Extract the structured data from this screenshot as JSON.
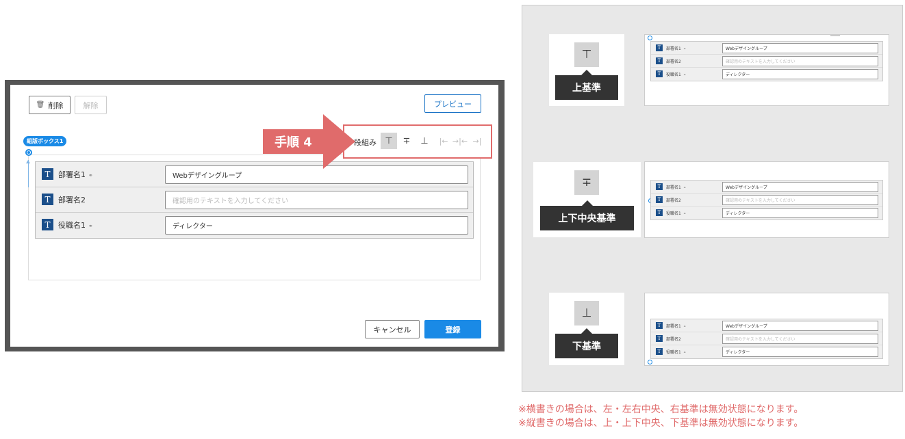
{
  "dialog": {
    "delete_label": "削除",
    "clear_label": "解除",
    "preview_label": "プレビュー",
    "box_tag": "組版ボックス1",
    "layout_label": "段組み",
    "cancel_label": "キャンセル",
    "register_label": "登録",
    "rows": [
      {
        "label": "部署名1",
        "value": "Webデザイングループ",
        "placeholder": false,
        "linked": true
      },
      {
        "label": "部署名2",
        "value": "確認用のテキストを入力してください",
        "placeholder": true,
        "linked": false
      },
      {
        "label": "役職名1",
        "value": "ディレクター",
        "placeholder": false,
        "linked": true
      }
    ],
    "align_buttons": [
      {
        "name": "align-top-icon",
        "glyph": "⊤",
        "active": true,
        "enabled": true
      },
      {
        "name": "align-middle-icon",
        "glyph": "∓",
        "active": false,
        "enabled": true
      },
      {
        "name": "align-bottom-icon",
        "glyph": "⊥",
        "active": false,
        "enabled": true
      },
      {
        "name": "align-left-icon",
        "glyph": "|←",
        "active": false,
        "enabled": false
      },
      {
        "name": "align-center-icon",
        "glyph": "→|←",
        "active": false,
        "enabled": false
      },
      {
        "name": "align-right-icon",
        "glyph": "→|",
        "active": false,
        "enabled": false
      }
    ]
  },
  "annotation": {
    "step_label": "手順 4",
    "accent_color": "#e06b6b"
  },
  "examples": [
    {
      "caption": "上基準",
      "glyph": "⊤"
    },
    {
      "caption": "上下中央基準",
      "glyph": "∓"
    },
    {
      "caption": "下基準",
      "glyph": "⊥"
    }
  ],
  "notes": [
    "※横書きの場合は、左・左右中央、右基準は無効状態になります。",
    "※縦書きの場合は、上・上下中央、下基準は無効状態になります。"
  ],
  "colors": {
    "primary": "#1a8ae6",
    "icon_bg": "#1b4f8a",
    "callout_bg": "#333333"
  }
}
